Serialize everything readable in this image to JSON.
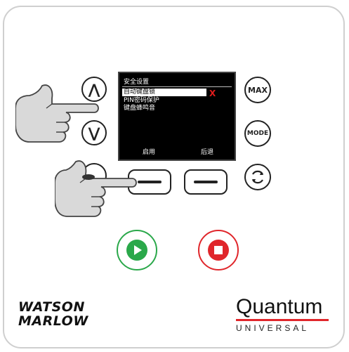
{
  "buttons": {
    "up_symbol": "⋀",
    "down_symbol": "⋁",
    "max_label": "MAX",
    "mode_label": "MODE"
  },
  "screen": {
    "title": "安全设置",
    "items": [
      "自动键盘锁",
      "PIN密码保护",
      "键盘蜂鸣音"
    ],
    "selected_mark": "X",
    "softkey_left": "启用",
    "softkey_right": "后退"
  },
  "brand": {
    "maker_line1": "WATSON",
    "maker_line2": "MARLOW",
    "product": "Quantum",
    "product_sub": "UNIVERSAL"
  },
  "colors": {
    "start_green": "#2aa84a",
    "stop_red": "#e0262b",
    "mark_red": "#e01c1c"
  },
  "icons": [
    "pointing-hand-icon",
    "play-icon",
    "stop-icon",
    "cycle-arrows-icon",
    "chevron-up-icon",
    "chevron-down-icon"
  ]
}
